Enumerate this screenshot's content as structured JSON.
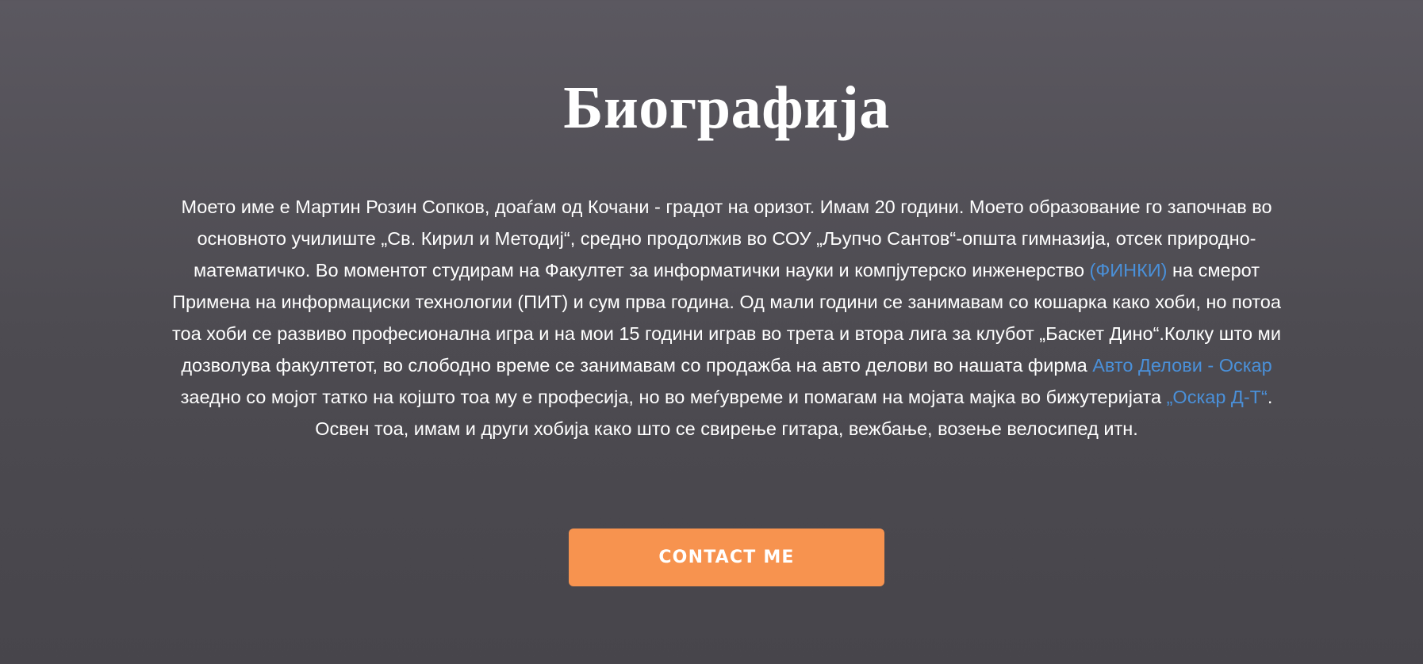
{
  "page": {
    "title": "Биографија"
  },
  "bio": {
    "part1": "Моето име е Мартин Розин Сопков, доаѓам од Кочани - градот на оризот. Имам 20 години. Моето образование го започнав во основното училиште „Св. Кирил и Методиј“, средно продолжив во СОУ „Љупчо Сантов“-општа гимназија, отсек природно-математичко. Во моментот студирам на Факултет за информатички науки и компјутерско инженерство ",
    "link1": "(ФИНКИ)",
    "part2": " на смерот Примена на информациски технологии (ПИТ) и сум прва година. Од мали години се занимавам со кошарка како хоби, но потоа тоа хоби се развиво професионална игра и на мои 15 години играв во трета и втора лига за клубот „Баскет Дино“.Колку што ми дозволува факултетот, во слободно време се занимавам со продажба на авто делови во нашата фирма ",
    "link2": "Авто Делови - Оскар",
    "part3": " заедно со мојот татко на којшто тоа му е професија, но во меѓувреме и помагам на мојата мајка во бижутеријата ",
    "link3": "„Оскар Д-Т“",
    "part4": ". Освен тоа, имам и други хобија како што се свирење гитара, вежбање, возење велосипед итн."
  },
  "cta": {
    "label": "CONTACT ME"
  },
  "colors": {
    "accent": "#f7934f",
    "link": "#4a90d9",
    "background_top": "#5b5860",
    "background_bottom": "#47454b"
  }
}
